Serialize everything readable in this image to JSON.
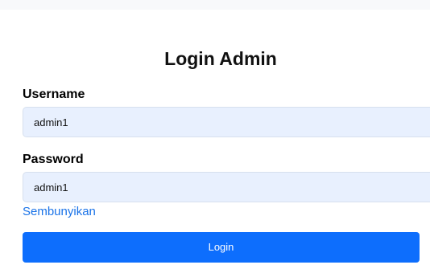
{
  "colors": {
    "background": "#ffffff",
    "input_fill": "#e8f0fe",
    "link": "#1a73e8",
    "button_primary": "#0d6efd",
    "button_text": "#ffffff"
  },
  "login": {
    "title": "Login Admin",
    "username": {
      "label": "Username",
      "value": "admin1"
    },
    "password": {
      "label": "Password",
      "value": "admin1"
    },
    "toggle_password_label": "Sembunyikan",
    "submit_label": "Login"
  }
}
